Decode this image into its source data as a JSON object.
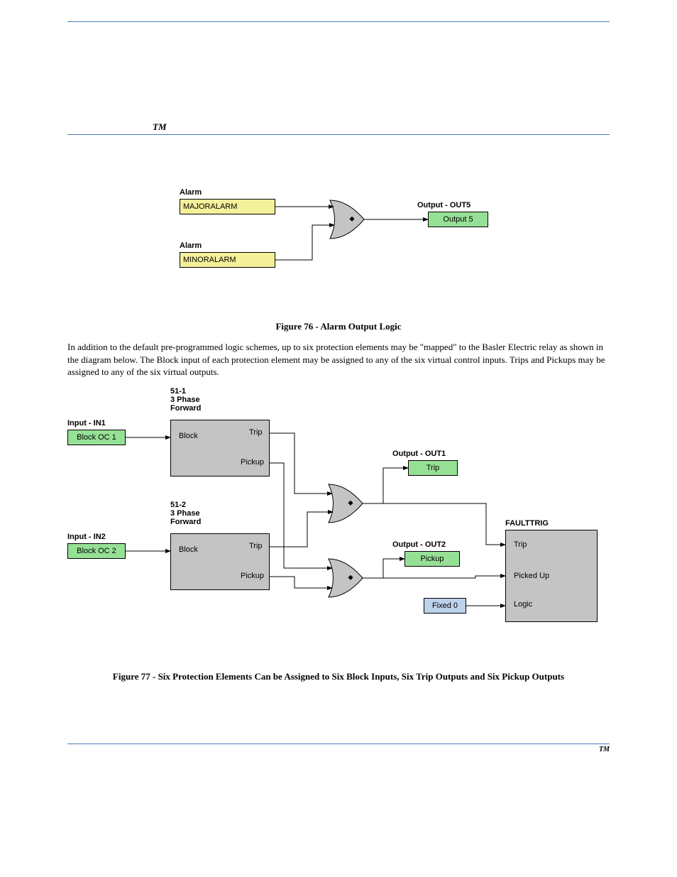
{
  "header_spacer": "",
  "tm": "TM",
  "fig1": {
    "alarm1_label": "Alarm",
    "alarm1_box": "MAJORALARM",
    "alarm2_label": "Alarm",
    "alarm2_box": "MINORALARM",
    "out_label": "Output - OUT5",
    "out_box": "Output 5"
  },
  "caption1": "Figure 76 - Alarm Output Logic",
  "para1": "In addition to the default pre-programmed logic schemes, up to six protection elements may be \"mapped\" to the Basler Electric relay as shown in the diagram below. The Block input of each protection element may be assigned to any of the six virtual control inputs. Trips and Pickups may be assigned to any of the six virtual outputs.",
  "fig2": {
    "in1_label": "Input - IN1",
    "in1_box": "Block OC 1",
    "in2_label": "Input - IN2",
    "in2_box": "Block OC 2",
    "blk1_title": "51-1\n3 Phase\nForward",
    "blk2_title": "51-2\n3 Phase\nForward",
    "pin_block": "Block",
    "pin_trip": "Trip",
    "pin_pickup": "Pickup",
    "out1_label": "Output - OUT1",
    "out1_box": "Trip",
    "out2_label": "Output - OUT2",
    "out2_box": "Pickup",
    "fixed0": "Fixed 0",
    "ft_label": "FAULTTRIG",
    "ft_trip": "Trip",
    "ft_pickedup": "Picked Up",
    "ft_logic": "Logic"
  },
  "caption2": "Figure 77 - Six Protection Elements Can be Assigned to Six Block Inputs, Six Trip Outputs and Six Pickup Outputs",
  "footer_right_tm": "TM"
}
